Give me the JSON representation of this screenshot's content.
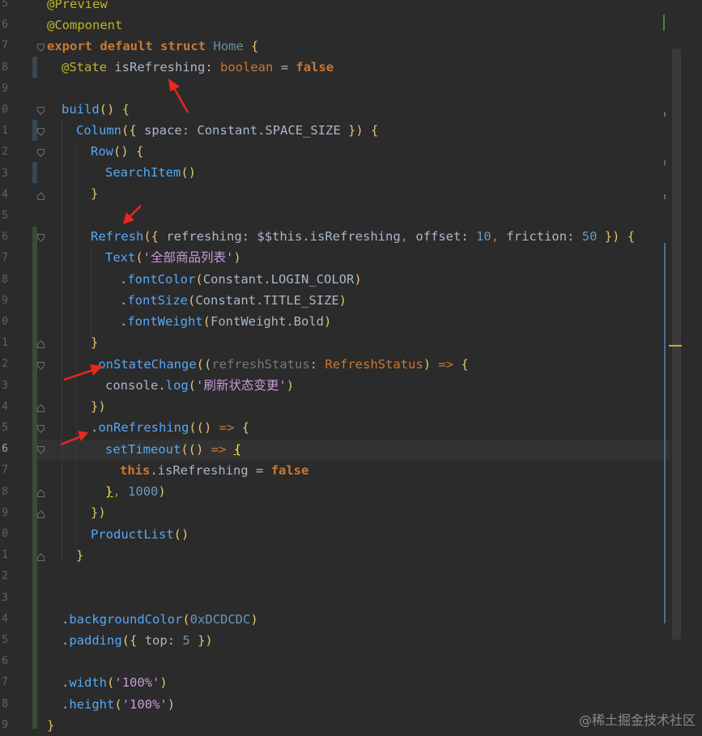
{
  "line_numbers": [
    "5",
    "6",
    "7",
    "8",
    "9",
    "0",
    "1",
    "2",
    "3",
    "4",
    "5",
    "6",
    "7",
    "8",
    "9",
    "0",
    "1",
    "2",
    "3",
    "4",
    "5",
    "6",
    "7",
    "8",
    "9",
    "0",
    "1",
    "2",
    "3",
    "4",
    "5",
    "6",
    "7",
    "8",
    "9"
  ],
  "code": {
    "l1": {
      "ann": "@Preview"
    },
    "l2": {
      "ann": "@Component"
    },
    "l3": {
      "kw1": "export",
      "kw2": "default",
      "kw3": "struct",
      "name": "Home",
      "brace": "{"
    },
    "l4": {
      "ann": "@State",
      "var": "isRefreshing",
      "colon": ":",
      "type": "boolean",
      "eq": "=",
      "val": "false"
    },
    "l6": {
      "fn": "build",
      "parens": "()",
      "brace": "{"
    },
    "l7": {
      "fn": "Column",
      "open": "({",
      "key": "space",
      "colon": ":",
      "obj": "Constant.SPACE_SIZE",
      "close": "})",
      "brace": "{"
    },
    "l8": {
      "fn": "Row",
      "parens": "()",
      "brace": "{"
    },
    "l9": {
      "fn": "SearchItem",
      "parens": "()"
    },
    "l10": {
      "brace": "}"
    },
    "l12": {
      "fn": "Refresh",
      "open": "({",
      "k1": "refreshing",
      "c1": ":",
      "v1": "$$this.isRefreshing",
      "comma1": ",",
      "k2": "offset",
      "c2": ":",
      "v2": "10",
      "comma2": ",",
      "k3": "friction",
      "c3": ":",
      "v3": "50",
      "close": "})",
      "brace": "{"
    },
    "l13": {
      "fn": "Text",
      "open": "(",
      "str": "'全部商品列表'",
      "close": ")"
    },
    "l14": {
      "dot": ".",
      "fn": "fontColor",
      "open": "(",
      "arg": "Constant.LOGIN_COLOR",
      "close": ")"
    },
    "l15": {
      "dot": ".",
      "fn": "fontSize",
      "open": "(",
      "arg": "Constant.TITLE_SIZE",
      "close": ")"
    },
    "l16": {
      "dot": ".",
      "fn": "fontWeight",
      "open": "(",
      "arg": "FontWeight.Bold",
      "close": ")"
    },
    "l17": {
      "brace": "}"
    },
    "l18": {
      "dot": ".",
      "fn": "onStateChange",
      "open": "((",
      "param": "refreshStatus",
      "colon": ":",
      "type": "RefreshStatus",
      "close": ")",
      "arrow": "=>",
      "brace": "{"
    },
    "l19": {
      "obj": "console",
      "dot": ".",
      "fn": "log",
      "open": "(",
      "str": "'刷新状态变更'",
      "close": ")"
    },
    "l20": {
      "close": "})"
    },
    "l21": {
      "dot": ".",
      "fn": "onRefreshing",
      "open": "(()",
      "arrow": "=>",
      "brace": "{"
    },
    "l22": {
      "fn": "setTimeout",
      "open": "(()",
      "arrow": "=>",
      "brace": "{"
    },
    "l23": {
      "kw": "this",
      "prop": ".isRefreshing",
      "eq": "=",
      "val": "false"
    },
    "l24": {
      "brace": "}",
      "comma": ",",
      "num": "1000",
      "close": ")"
    },
    "l25": {
      "close": "})"
    },
    "l26": {
      "fn": "ProductList",
      "parens": "()"
    },
    "l27": {
      "brace": "}"
    },
    "l30": {
      "dot": ".",
      "fn": "backgroundColor",
      "open": "(",
      "num": "0xDCDCDC",
      "close": ")"
    },
    "l31": {
      "dot": ".",
      "fn": "padding",
      "open": "({",
      "key": "top",
      "colon": ":",
      "num": "5",
      "close": "})"
    },
    "l33": {
      "dot": ".",
      "fn": "width",
      "open": "(",
      "str": "'100%'",
      "close": ")"
    },
    "l34": {
      "dot": ".",
      "fn": "height",
      "open": "(",
      "str": "'100%'",
      "close": ")"
    },
    "l35": {
      "brace": "}"
    }
  },
  "colors": {
    "arrow": "#e8281c",
    "background": "#2b2b2b"
  },
  "watermark": "@稀土掘金技术社区"
}
